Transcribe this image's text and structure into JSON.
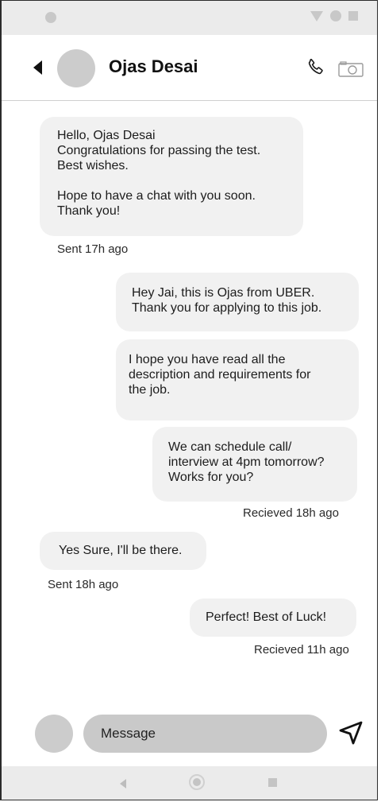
{
  "contact": {
    "name": "Ojas Desai"
  },
  "messages": [
    {
      "direction": "sent",
      "text": "Hello, Ojas Desai\nCongratulations for passing the test.\nBest wishes.\n\nHope to have a chat with you soon.\nThank you!",
      "meta": "Sent 17h ago"
    },
    {
      "direction": "received",
      "text": "Hey Jai, this is Ojas from UBER.\nThank you for applying to this job.",
      "meta": ""
    },
    {
      "direction": "received",
      "text": " I hope you have read all the\ndescription and requirements for\nthe job.",
      "meta": ""
    },
    {
      "direction": "received",
      "text": "We can schedule call/\ninterview at 4pm tomorrow?\nWorks for you?",
      "meta": "Recieved 18h ago"
    },
    {
      "direction": "sent",
      "text": "Yes Sure, I'll be there.",
      "meta": "Sent 18h ago"
    },
    {
      "direction": "received",
      "text": "Perfect! Best of Luck!",
      "meta": "Recieved 11h ago"
    }
  ],
  "composer": {
    "placeholder": "Message"
  },
  "icons": {
    "back": "back-arrow-icon",
    "call": "phone-icon",
    "video": "camera-icon",
    "send": "send-icon"
  },
  "colors": {
    "bubble": "#f1f1f1",
    "input": "#c9c9c9",
    "avatar": "#cccccc"
  }
}
